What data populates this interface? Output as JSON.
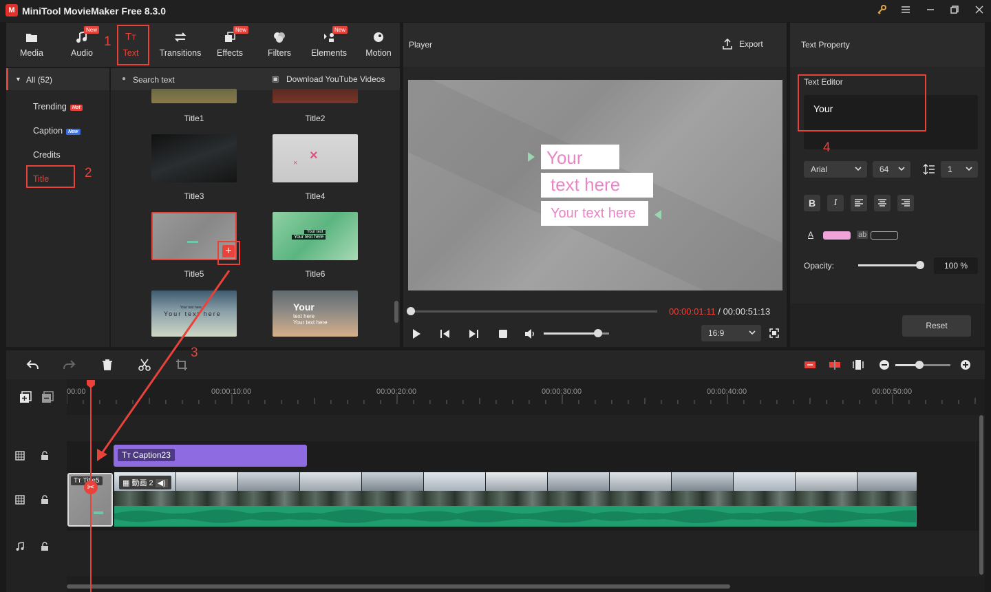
{
  "app": {
    "logo": "M",
    "title": "MiniTool MovieMaker Free 8.3.0"
  },
  "window": {
    "icons": [
      "key-icon",
      "menu-icon",
      "minimize-icon",
      "maximize-icon",
      "close-icon"
    ]
  },
  "toolbar": {
    "items": [
      {
        "label": "Media",
        "icon": "media-icon"
      },
      {
        "label": "Audio",
        "icon": "audio-icon",
        "badge": "New"
      },
      {
        "label": "Text",
        "icon": "text-icon",
        "active": true
      },
      {
        "label": "Transitions",
        "icon": "transitions-icon"
      },
      {
        "label": "Effects",
        "icon": "effects-icon",
        "badge": "New"
      },
      {
        "label": "Filters",
        "icon": "filters-icon"
      },
      {
        "label": "Elements",
        "icon": "elements-icon",
        "badge": "New"
      },
      {
        "label": "Motion",
        "icon": "motion-icon"
      }
    ]
  },
  "annotations": {
    "n1": "1",
    "n2": "2",
    "n3": "3",
    "n4": "4"
  },
  "categories": {
    "all": "All (52)",
    "items": [
      {
        "label": "Trending",
        "tag": "Hot"
      },
      {
        "label": "Caption",
        "tag": "New"
      },
      {
        "label": "Credits"
      },
      {
        "label": "Title",
        "selected": true
      }
    ]
  },
  "library": {
    "search": "Search text",
    "download": "Download YouTube Videos",
    "titles": [
      "Title1",
      "Title2",
      "Title3",
      "Title4",
      "Title5",
      "Title6"
    ],
    "thumb_text": {
      "t6_top": "Your text",
      "t6_main": "Your text here",
      "t7_top": "Your text here",
      "t7_main": "Your text here",
      "t8_big": "Your",
      "t8_l2": "text here",
      "t8_l3": "Your text here"
    }
  },
  "player": {
    "title": "Player",
    "export": "Export",
    "current": "00:00:01:11",
    "sep": " / ",
    "total": "00:00:51:13",
    "progress": 0.012,
    "volume": 0.83,
    "aspect": "16:9",
    "preview": {
      "l1": "Your",
      "l2": "text here",
      "l3": "Your text here"
    }
  },
  "property": {
    "title": "Text Property",
    "editor_label": "Text Editor",
    "editor_value": "Your",
    "font": "Arial",
    "size": "64",
    "line_spacing": "1",
    "format_icons": [
      "bold-icon",
      "italic-icon",
      "align-left-icon",
      "align-center-icon",
      "align-right-icon"
    ],
    "bold": "B",
    "italic": "I",
    "text_color": "#f0a3d8",
    "outline_label": "ab",
    "opacity_label": "Opacity:",
    "opacity_value": "100 %",
    "opacity": 1.0,
    "reset": "Reset"
  },
  "timeline": {
    "ruler": [
      "00:00",
      "00:00:10:00",
      "00:00:20:00",
      "00:00:30:00",
      "00:00:40:00",
      "00:00:50:00"
    ],
    "caption_clip": "Caption23",
    "video_clip": "動画 2",
    "title_clip": "Title5"
  }
}
